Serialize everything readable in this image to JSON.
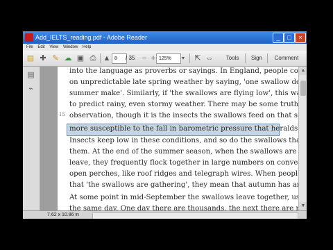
{
  "window": {
    "title": "Add_IELTS_reading.pdf - Adobe Reader",
    "controls": {
      "minimize": "_",
      "maximize": "□",
      "close": "×"
    }
  },
  "menu": [
    "File",
    "Edit",
    "View",
    "Window",
    "Help"
  ],
  "toolbar": {
    "page_current": "8",
    "page_total": "/ 35",
    "zoom": "125%",
    "tools_label": "Tools",
    "sign_label": "Sign",
    "comment_label": "Comment"
  },
  "document": {
    "line_number": "15",
    "lines": [
      "into the language as proverbs or sayings. In England, people comment",
      "on unpredictable late spring weather by saying, 'one swallow does not a",
      "summer make'. Similarly, if 'the swallows are flying low', this was held",
      "to predict rainy, even stormy weather. There may be some truth in this",
      "observation, though it is the insects the swallows feed on that seem to be",
      "more susceptible to the fall in barometric pressure that heralds a storm.",
      "Insects keep low in these conditions, and so do the swallows that hunt",
      "them. At the end of the summer season, when the swallows are about to",
      "leave, they frequently flock together in large numbers on convenient high",
      "open perches, like roof ridges and telegraph wires. When people remark",
      "that 'the swallows are gathering', they mean that autumn has arrived.",
      "At some point in mid-September the swallows leave together, usually all on",
      "the same day. One day there are thousands, the next there are none, and"
    ]
  },
  "statusbar": {
    "dimensions": "7.62 x 10.86 in"
  },
  "colors": {
    "titlebar": "#2a6fd6",
    "highlight": "#96b2cd",
    "highlight_border": "#6d8aa8"
  }
}
